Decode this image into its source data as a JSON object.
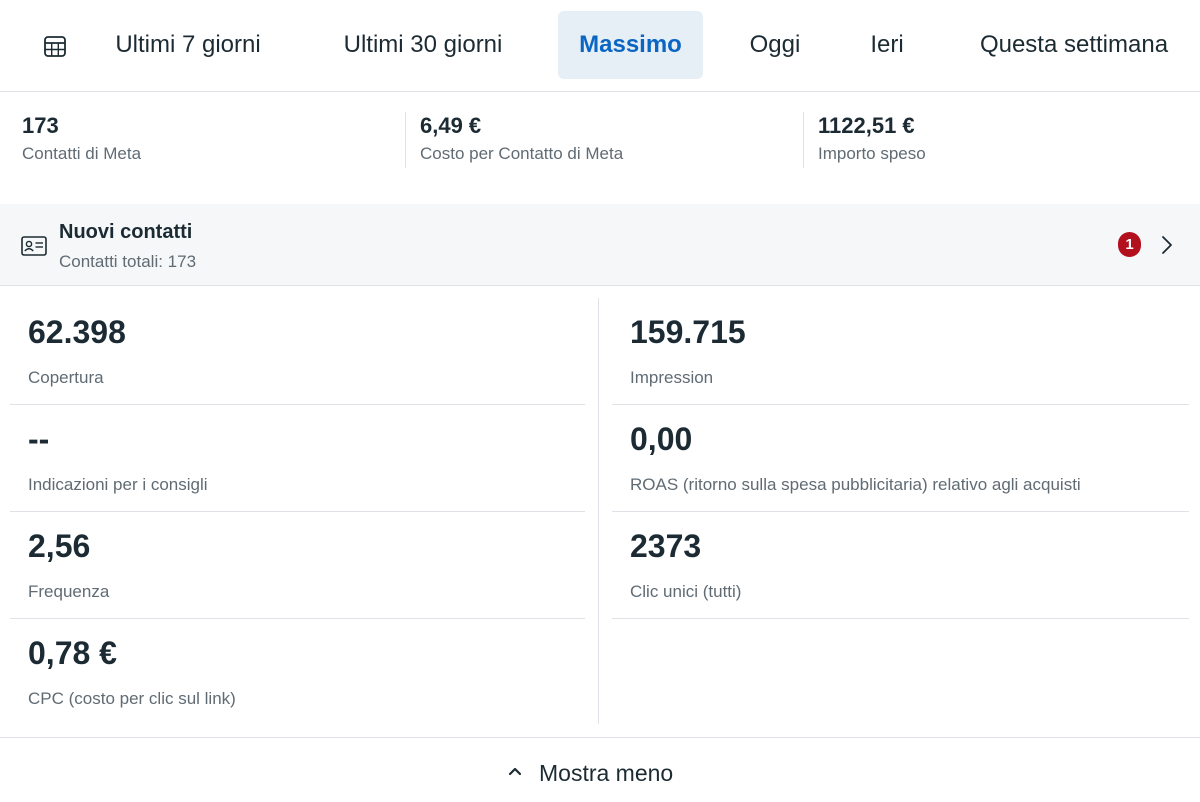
{
  "tabs": [
    {
      "label": "Ultimi 7 giorni",
      "active": false
    },
    {
      "label": "Ultimi 30 giorni",
      "active": false
    },
    {
      "label": "Massimo",
      "active": true
    },
    {
      "label": "Oggi",
      "active": false
    },
    {
      "label": "Ieri",
      "active": false
    },
    {
      "label": "Questa settimana",
      "active": false
    }
  ],
  "summary": [
    {
      "value": "173",
      "label": "Contatti di Meta"
    },
    {
      "value": "6,49 €",
      "label": "Costo per Contatto di Meta"
    },
    {
      "value": "1122,51 €",
      "label": "Importo speso"
    }
  ],
  "contacts": {
    "title": "Nuovi contatti",
    "subtitle": "Contatti totali: 173",
    "badge": "1"
  },
  "metrics_left": [
    {
      "value": "62.398",
      "label": "Copertura"
    },
    {
      "value": "--",
      "label": "Indicazioni per i consigli"
    },
    {
      "value": "2,56",
      "label": "Frequenza"
    },
    {
      "value": "0,78 €",
      "label": "CPC (costo per clic sul link)"
    }
  ],
  "metrics_right": [
    {
      "value": "159.715",
      "label": "Impression"
    },
    {
      "value": "0,00",
      "label": "ROAS (ritorno sulla spesa pubblicitaria) relativo agli acquisti"
    },
    {
      "value": "2373",
      "label": "Clic unici (tutti)"
    }
  ],
  "footer": {
    "show_less_label": "Mostra meno"
  },
  "colors": {
    "accent": "#0a66c2",
    "active_tab_bg": "#e6eef6",
    "badge": "#b3101e",
    "text": "#1c2b33",
    "muted": "#606b74"
  },
  "icons": {
    "calendar": "calendar-icon",
    "contact_card": "contact-card-icon",
    "chevron_right": "chevron-right-icon",
    "chevron_up": "chevron-up-icon"
  }
}
